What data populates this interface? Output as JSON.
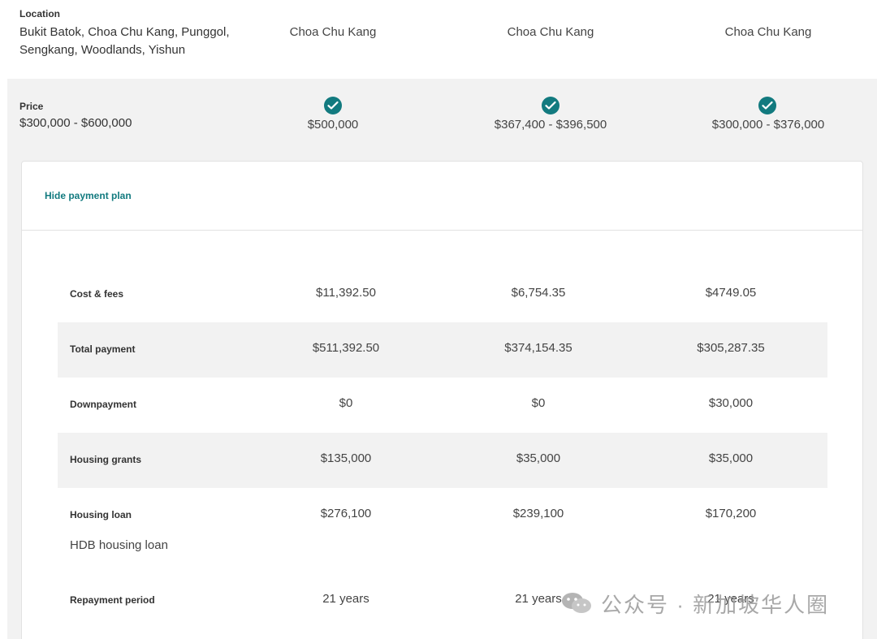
{
  "location": {
    "label": "Location",
    "criteria": "Bukit Batok, Choa Chu Kang, Punggol, Sengkang, Woodlands, Yishun",
    "columns": [
      "Choa Chu Kang",
      "Choa Chu Kang",
      "Choa Chu Kang"
    ]
  },
  "price": {
    "label": "Price",
    "criteria": "$300,000 - $600,000",
    "columns": [
      "$500,000",
      "$367,400 - $396,500",
      "$300,000 - $376,000"
    ],
    "check_icon": "check-circle-icon",
    "accent_color": "#127a7f"
  },
  "payment_plan": {
    "toggle_label": "Hide payment plan",
    "rows": [
      {
        "label": "Cost & fees",
        "values": [
          "$11,392.50",
          "$6,754.35",
          "$4749.05"
        ],
        "shaded": false
      },
      {
        "label": "Total payment",
        "values": [
          "$511,392.50",
          "$374,154.35",
          "$305,287.35"
        ],
        "shaded": true
      },
      {
        "label": "Downpayment",
        "values": [
          "$0",
          "$0",
          "$30,000"
        ],
        "shaded": false
      },
      {
        "label": "Housing grants",
        "values": [
          "$135,000",
          "$35,000",
          "$35,000"
        ],
        "shaded": true
      },
      {
        "label": "Housing loan",
        "values": [
          "$276,100",
          "$239,100",
          "$170,200"
        ],
        "shaded": false,
        "sublabel": "HDB housing loan"
      },
      {
        "label": "Repayment period",
        "values": [
          "21 years",
          "21 years",
          "21 years"
        ],
        "shaded": false
      }
    ]
  },
  "watermark": {
    "text": "公众号 · 新加坡华人圈",
    "icon": "wechat-icon"
  }
}
